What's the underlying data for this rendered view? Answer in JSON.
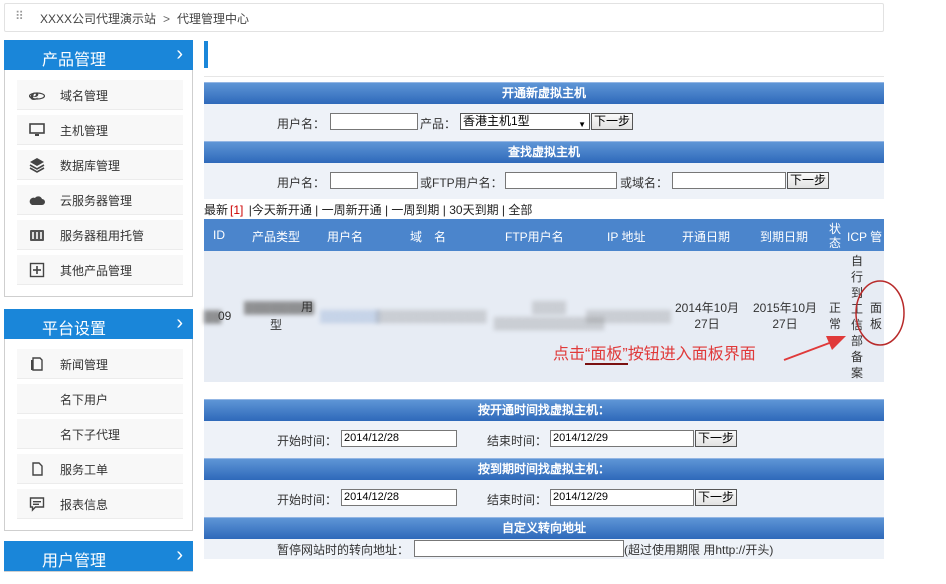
{
  "breadcrumb": {
    "site": "XXXX公司代理演示站",
    "separator": ">",
    "current": "代理管理中心"
  },
  "sidebar": {
    "sections": [
      {
        "title": "产品管理",
        "items": [
          "域名管理",
          "主机管理",
          "数据库管理",
          "云服务器管理",
          "服务器租用托管",
          "其他产品管理"
        ]
      },
      {
        "title": "平台设置",
        "items": [
          "新闻管理",
          "名下用户",
          "名下子代理",
          "服务工单",
          "报表信息"
        ]
      },
      {
        "title": "用户管理"
      }
    ]
  },
  "new_host": {
    "title": "开通新虚拟主机",
    "username_label": "用户名：",
    "product_label": "产品：",
    "product_selected": "香港主机1型",
    "next_label": "下一步"
  },
  "find_host": {
    "title": "查找虚拟主机",
    "username_label": "用户名：",
    "ftp_label": "或FTP用户名：",
    "domain_label": "或域名：",
    "next_label": "下一步"
  },
  "filter": {
    "latest": "最新",
    "count": "[1]",
    "links": [
      "|今天新开通",
      "| 一周新开通",
      "| 一周到期",
      "| 30天到期",
      "| 全部"
    ]
  },
  "table": {
    "headers": [
      "ID",
      "产品类型",
      "用户名",
      "域　名",
      "FTP用户名",
      "IP 地址",
      "开通日期",
      "到期日期",
      "状态",
      "ICP 管"
    ],
    "row": {
      "id": "09",
      "product_suffix": "用",
      "product_line2": "型",
      "open_date": "2014年10月27日",
      "expire_date": "2015年10月27日",
      "status": "正常",
      "icp": "自行到工信部备案",
      "panel": "面板"
    }
  },
  "annotation": {
    "prefix": "点击",
    "highlight": "“面板”",
    "suffix": "按钮进入面板界面"
  },
  "open_time_search": {
    "title": "按开通时间找虚拟主机：",
    "start_label": "开始时间：",
    "start_value": "2014/12/28",
    "end_label": "结束时间：",
    "end_value": "2014/12/29",
    "next_label": "下一步"
  },
  "expire_time_search": {
    "title": "按到期时间找虚拟主机：",
    "start_label": "开始时间：",
    "start_value": "2014/12/28",
    "end_label": "结束时间：",
    "end_value": "2014/12/29",
    "next_label": "下一步"
  },
  "redirect": {
    "title": "自定义转向地址",
    "label": "暂停网站时的转向地址：",
    "hint": "(超过使用期限 用http://开头)"
  },
  "colors": {
    "accent": "#1a86d9",
    "header_bar": "#3f78c4",
    "annotation": "#e03a3a"
  }
}
